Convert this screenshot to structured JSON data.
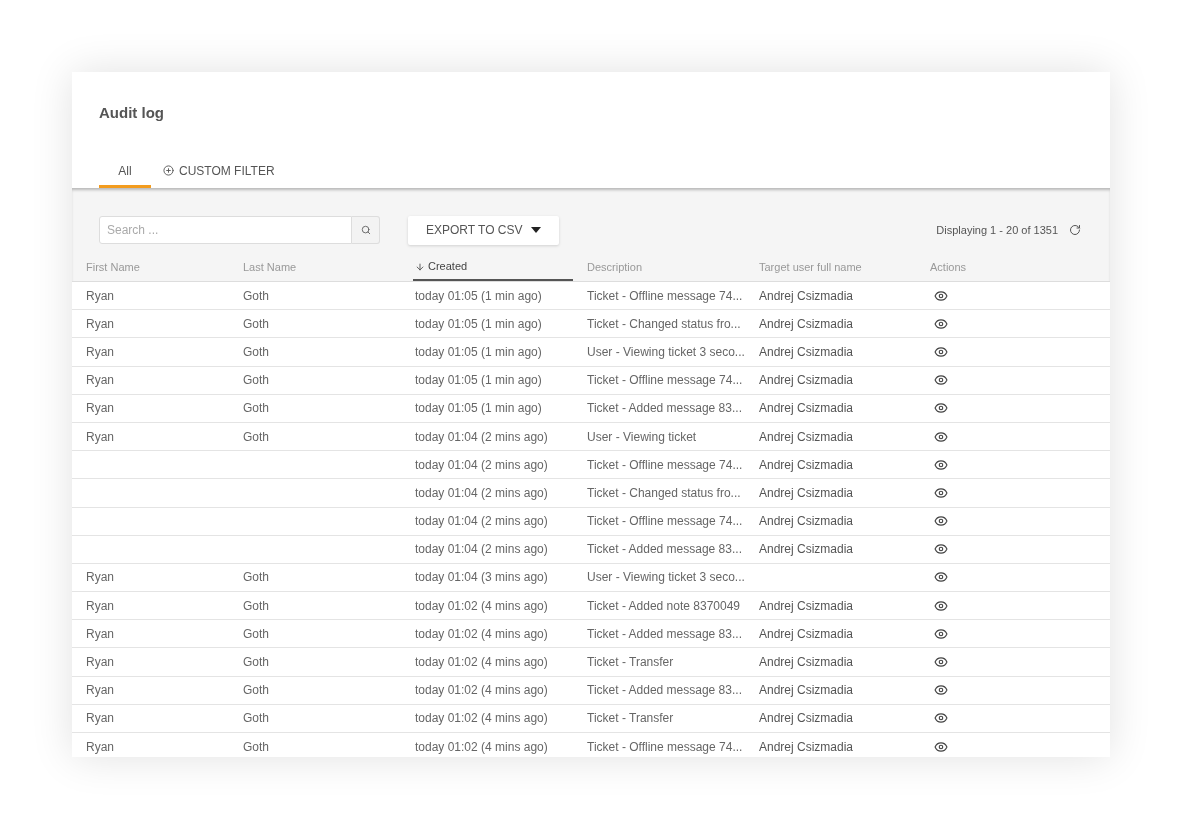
{
  "title": "Audit log",
  "tabs": [
    {
      "label": "All",
      "selected": true,
      "kind": "plain"
    },
    {
      "label": "CUSTOM FILTER",
      "selected": false,
      "kind": "add"
    }
  ],
  "search": {
    "placeholder": "Search ..."
  },
  "export_button": {
    "label": "EXPORT TO CSV"
  },
  "pagination": {
    "text": "Displaying 1 - 20 of 1351"
  },
  "table": {
    "columns": [
      {
        "label": "First Name",
        "sorted": false
      },
      {
        "label": "Last Name",
        "sorted": false
      },
      {
        "label": "Created",
        "sorted": true
      },
      {
        "label": "Description",
        "sorted": false
      },
      {
        "label": "Target user full name",
        "sorted": false
      },
      {
        "label": "Actions",
        "sorted": false
      }
    ],
    "rows": [
      {
        "first_name": "Ryan",
        "last_name": "Goth",
        "created": "today 01:05 (1 min ago)",
        "description": "Ticket - Offline message 74...",
        "target": "Andrej Csizmadia"
      },
      {
        "first_name": "Ryan",
        "last_name": "Goth",
        "created": "today 01:05 (1 min ago)",
        "description": "Ticket - Changed status fro...",
        "target": "Andrej Csizmadia"
      },
      {
        "first_name": "Ryan",
        "last_name": "Goth",
        "created": "today 01:05 (1 min ago)",
        "description": "User - Viewing ticket 3 seco...",
        "target": "Andrej Csizmadia"
      },
      {
        "first_name": "Ryan",
        "last_name": "Goth",
        "created": "today 01:05 (1 min ago)",
        "description": "Ticket - Offline message 74...",
        "target": "Andrej Csizmadia"
      },
      {
        "first_name": "Ryan",
        "last_name": "Goth",
        "created": "today 01:05 (1 min ago)",
        "description": "Ticket - Added message 83...",
        "target": "Andrej Csizmadia"
      },
      {
        "first_name": "Ryan",
        "last_name": "Goth",
        "created": "today 01:04 (2 mins ago)",
        "description": "User - Viewing ticket",
        "target": "Andrej Csizmadia"
      },
      {
        "created": "today 01:04 (2 mins ago)",
        "description": "Ticket - Offline message 74...",
        "target": "Andrej Csizmadia"
      },
      {
        "created": "today 01:04 (2 mins ago)",
        "description": "Ticket - Changed status fro...",
        "target": "Andrej Csizmadia"
      },
      {
        "created": "today 01:04 (2 mins ago)",
        "description": "Ticket - Offline message 74...",
        "target": "Andrej Csizmadia"
      },
      {
        "created": "today 01:04 (2 mins ago)",
        "description": "Ticket - Added message 83...",
        "target": "Andrej Csizmadia"
      },
      {
        "first_name": "Ryan",
        "last_name": "Goth",
        "created": "today 01:04 (3 mins ago)",
        "description": "User - Viewing ticket 3 seco..."
      },
      {
        "first_name": "Ryan",
        "last_name": "Goth",
        "created": "today 01:02 (4 mins ago)",
        "description": "Ticket - Added note 8370049",
        "target": "Andrej Csizmadia"
      },
      {
        "first_name": "Ryan",
        "last_name": "Goth",
        "created": "today 01:02 (4 mins ago)",
        "description": "Ticket - Added message 83...",
        "target": "Andrej Csizmadia"
      },
      {
        "first_name": "Ryan",
        "last_name": "Goth",
        "created": "today 01:02 (4 mins ago)",
        "description": "Ticket - Transfer",
        "target": "Andrej Csizmadia"
      },
      {
        "first_name": "Ryan",
        "last_name": "Goth",
        "created": "today 01:02 (4 mins ago)",
        "description": "Ticket - Added message 83...",
        "target": "Andrej Csizmadia"
      },
      {
        "first_name": "Ryan",
        "last_name": "Goth",
        "created": "today 01:02 (4 mins ago)",
        "description": "Ticket - Transfer",
        "target": "Andrej Csizmadia"
      },
      {
        "first_name": "Ryan",
        "last_name": "Goth",
        "created": "today 01:02 (4 mins ago)",
        "description": "Ticket - Offline message 74...",
        "target": "Andrej Csizmadia"
      }
    ]
  }
}
